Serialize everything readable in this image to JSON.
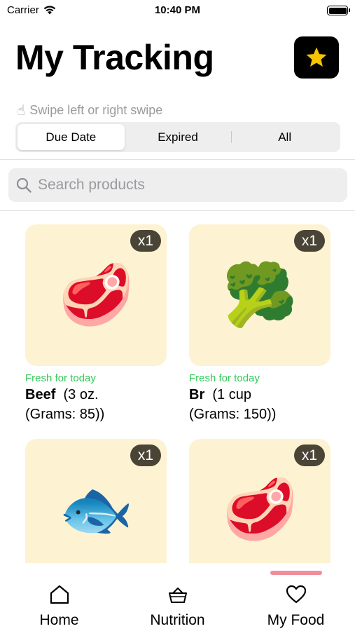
{
  "status_bar": {
    "carrier": "Carrier",
    "time": "10:40 PM"
  },
  "header": {
    "title": "My Tracking",
    "star_icon": "star-icon",
    "star_color": "#f5c400"
  },
  "hint": {
    "icon": "☝",
    "text": "Swipe left or right swipe"
  },
  "segments": [
    {
      "label": "Due Date",
      "active": true
    },
    {
      "label": "Expired",
      "active": false
    },
    {
      "label": "All",
      "active": false
    }
  ],
  "search": {
    "placeholder": "Search products",
    "value": ""
  },
  "products": [
    {
      "emoji": "🥩",
      "quantity": "x1",
      "status": "Fresh for today",
      "name": "Beef",
      "detail": "(3 oz.",
      "detail2": "(Grams: 85))"
    },
    {
      "emoji": "🥦",
      "quantity": "x1",
      "status": "Fresh for today",
      "name": "Br",
      "detail": "(1 cup",
      "detail2": "(Grams: 150))"
    },
    {
      "emoji": "🐟",
      "quantity": "x1"
    },
    {
      "emoji": "🥩",
      "quantity": "x1"
    }
  ],
  "tabs": [
    {
      "label": "Home",
      "icon": "house-icon",
      "active": false
    },
    {
      "label": "Nutrition",
      "icon": "basket-icon",
      "active": false
    },
    {
      "label": "My Food",
      "icon": "heart-icon",
      "active": true
    }
  ],
  "colors": {
    "accent": "#f18d9a",
    "fresh": "#34c759",
    "tile": "#fdf3d2",
    "badge": "#4a4436"
  }
}
